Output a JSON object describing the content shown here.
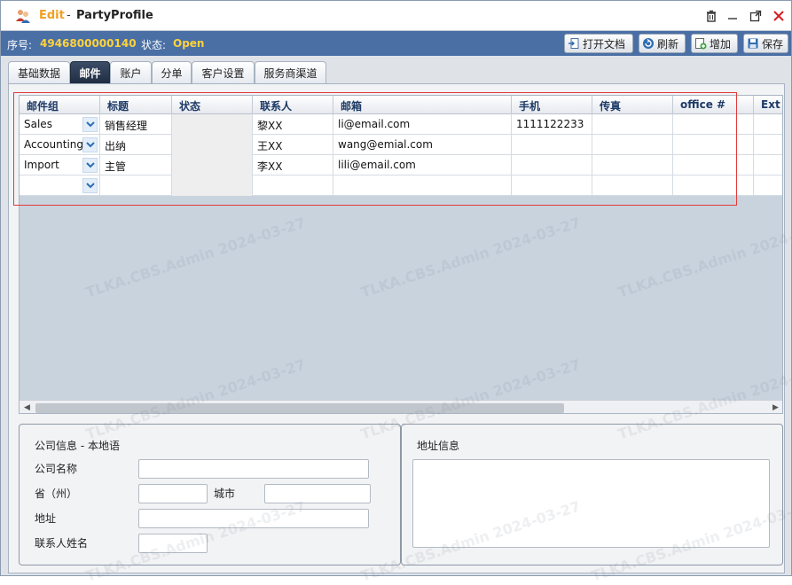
{
  "window": {
    "mode": "Edit",
    "separator": "-",
    "title": "PartyProfile"
  },
  "infobar": {
    "seq_label": "序号:",
    "seq_value": "4946800000140",
    "status_label": "状态:",
    "status_value": "Open",
    "buttons": {
      "open_doc": "打开文档",
      "refresh": "刷新",
      "add": "增加",
      "save": "保存"
    }
  },
  "tabs": [
    "基础数据",
    "邮件",
    "账户",
    "分单",
    "客户设置",
    "服务商渠道"
  ],
  "grid": {
    "columns": [
      "邮件组",
      "标题",
      "状态",
      "联系人",
      "邮箱",
      "手机",
      "传真",
      "office #",
      "Ext #"
    ],
    "rows": [
      [
        "Sales",
        "销售经理",
        "",
        "黎XX",
        "li@email.com",
        "1111122233",
        "",
        "",
        ""
      ],
      [
        "Accounting",
        "出纳",
        "",
        "王XX",
        "wang@emial.com",
        "",
        "",
        "",
        ""
      ],
      [
        "Import",
        "主管",
        "",
        "李XX",
        "lili@email.com",
        "",
        "",
        "",
        ""
      ],
      [
        "",
        "",
        "",
        "",
        "",
        "",
        "",
        "",
        ""
      ]
    ]
  },
  "company_panel": {
    "title": "公司信息 - 本地语",
    "company_name_label": "公司名称",
    "province_label": "省（州）",
    "city_label": "城市",
    "address_label": "地址",
    "contact_name_label": "联系人姓名"
  },
  "address_panel": {
    "title": "地址信息"
  },
  "watermark": "TLKA.CBS.Admin 2024-03-27",
  "colors": {
    "infobar_bg": "#4a6fa5",
    "accent_yellow": "#ffd23c",
    "edit_orange": "#f0a020",
    "header_text": "#1d3a66",
    "highlight_red": "#e23a3a"
  }
}
